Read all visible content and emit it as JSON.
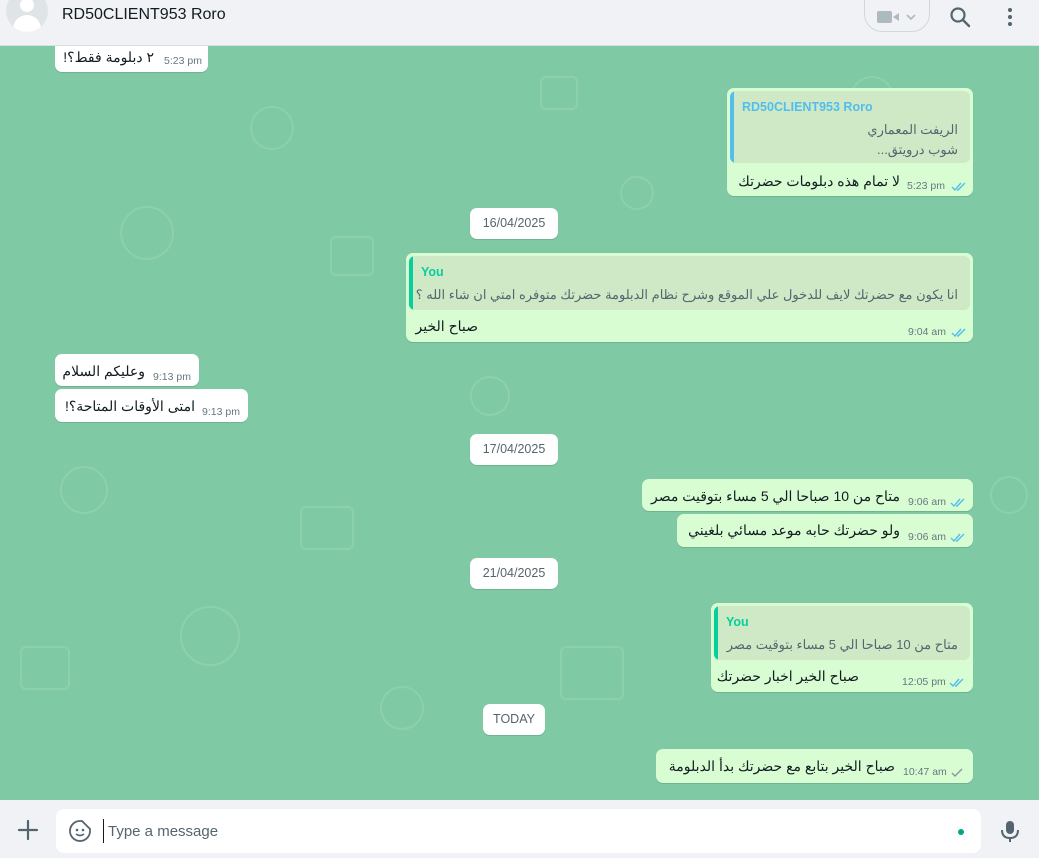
{
  "header": {
    "contact_name": "RD50CLIENT953 Roro",
    "icons": [
      "avatar-icon",
      "video-call-icon",
      "search-icon",
      "menu-icon"
    ]
  },
  "messages": {
    "m1": {
      "text": "٢ دبلومة فقط؟!",
      "time": "5:23 pm"
    },
    "m2": {
      "quote_name": "RD50CLIENT953 Roro",
      "quote_line1": "الريفت المعماري",
      "quote_line2": "شوب درويتق...",
      "text": "لا تمام هذه دبلومات حضرتك",
      "time": "5:23 pm"
    },
    "d1": "16/04/2025",
    "m3": {
      "quote_name": "You",
      "quote_line1": "انا يكون مع حضرتك لايف للدخول علي الموقع وشرح نظام الدبلومة حضرتك متوفره امتي ان شاء الله ؟",
      "text": "صباح الخير",
      "time": "9:04 am"
    },
    "m4": {
      "text": "وعليكم السلام",
      "time": "9:13 pm"
    },
    "m5": {
      "text": "امتى الأوقات المتاحة؟!",
      "time": "9:13 pm"
    },
    "d2": "17/04/2025",
    "m6": {
      "text": "متاح من 10 صباحا الي 5 مساء بتوقيت مصر",
      "time": "9:06 am"
    },
    "m7": {
      "text": "ولو حضرتك حابه موعد مسائي بلغيني",
      "time": "9:06 am"
    },
    "d3": "21/04/2025",
    "m8": {
      "quote_name": "You",
      "quote_line1": "متاح من 10 صباحا الي 5 مساء بتوقيت مصر",
      "text": "صباح الخير اخبار حضرتك",
      "time": "12:05 pm"
    },
    "d4": "TODAY",
    "m9": {
      "text": "صباح الخير بتابع مع حضرتك بدأ الدبلومة",
      "time": "10:47 am"
    }
  },
  "composer": {
    "placeholder": "Type a message",
    "icons": [
      "plus-icon",
      "sticker-icon",
      "mic-icon"
    ]
  },
  "colors": {
    "incoming": "#ffffff",
    "outgoing": "#d9fdd3",
    "read_ticks": "#53bdeb",
    "accent": "#00a884",
    "quote_name_contact": "#53bdeb",
    "quote_name_you": "#06cf9c",
    "chat_bg": "#7fc9a5"
  }
}
